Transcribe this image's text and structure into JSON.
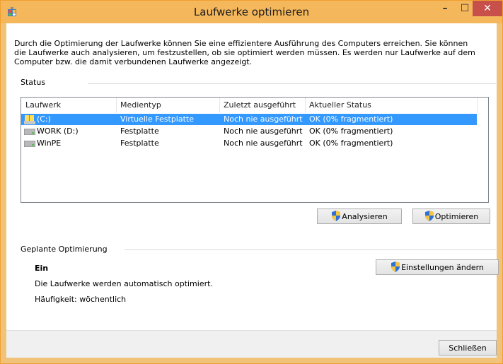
{
  "window": {
    "title": "Laufwerke optimieren",
    "minimize": "–",
    "maximize": "☐",
    "close": "✕",
    "accent": "#f5b75c"
  },
  "description": "Durch die Optimierung der Laufwerke können Sie eine effizientere Ausführung des Computers erreichen. Sie können die Laufwerke auch analysieren, um festzustellen, ob sie optimiert werden müssen. Es werden nur Laufwerke auf dem Computer bzw. die damit verbundenen Laufwerke angezeigt.",
  "status": {
    "label": "Status",
    "columns": [
      "Laufwerk",
      "Medientyp",
      "Zuletzt ausgeführt",
      "Aktueller Status"
    ],
    "rows": [
      {
        "drive": "(C:)",
        "media": "Virtuelle Festplatte",
        "last": "Noch nie ausgeführt",
        "state": "OK (0% fragmentiert)",
        "icon": "windows-drive-icon",
        "selected": true
      },
      {
        "drive": "WORK (D:)",
        "media": "Festplatte",
        "last": "Noch nie ausgeführt",
        "state": "OK (0% fragmentiert)",
        "icon": "hard-drive-icon",
        "selected": false
      },
      {
        "drive": "WinPE",
        "media": "Festplatte",
        "last": "Noch nie ausgeführt",
        "state": "OK (0% fragmentiert)",
        "icon": "hard-drive-icon",
        "selected": false
      }
    ],
    "analyze_label": "Analysieren",
    "optimize_label": "Optimieren"
  },
  "scheduled": {
    "label": "Geplante Optimierung",
    "state": "Ein",
    "info": "Die Laufwerke werden automatisch optimiert.",
    "frequency": "Häufigkeit: wöchentlich",
    "change_settings_label": "Einstellungen ändern"
  },
  "close_label": "Schließen",
  "colors": {
    "selection": "#3399ff",
    "title_bar": "#f5b75c"
  }
}
